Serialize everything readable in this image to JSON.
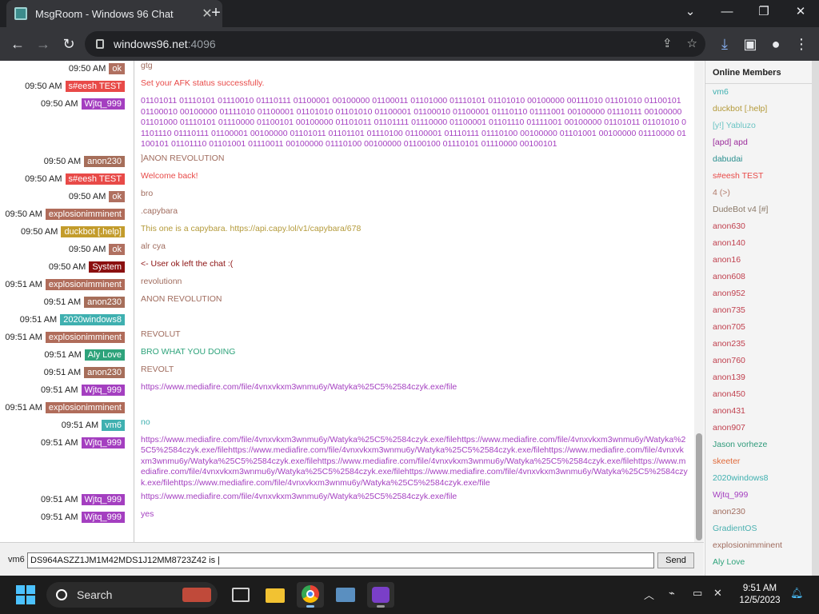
{
  "browser": {
    "tab_title": "MsgRoom - Windows 96 Chat",
    "url_host": "windows96.net",
    "url_port": ":4096"
  },
  "chat": {
    "messages": [
      {
        "time": "09:50 AM",
        "user": "ok",
        "user_color": "#b07060",
        "text": "gtg",
        "text_color": "#a06c5e"
      },
      {
        "time": "09:50 AM",
        "user": "s#eesh TEST",
        "user_color": "#e84a48",
        "text": "Set your AFK status successfully.",
        "text_color": "#e84a48"
      },
      {
        "time": "09:50 AM",
        "user": "Wjtq_999",
        "user_color": "#a43fc0",
        "text": "01101011 01110101 01110010 01110111 01100001 00100000 01100011 01101000 01110101 01101010 00100000 00111010 01101010 01100101 01100010 00100000 01111010 01100001 01101010 01101010 01100001 01100010 01100001 01110110 01111001 00100000 01110111 00100000 01101000 01110101 01110000 01100101 00100000 01101011 01101111 01110000 01100001 01101110 01111001 00100000 01101011 01101010 01101110 01110111 01100001 00100000 01101011 01101101 01110100 01100001 01110111 01110100 00100000 01101001 00100000 01110000 01100101 01101110 01101001 01110011 00100000 01110100 00100000 01100100 01110101 01110000 00100101",
        "text_color": "#a43fc0"
      },
      {
        "time": "09:50 AM",
        "user": "anon230",
        "user_color": "#a66e5a",
        "text": "]ANON REVOLUTION",
        "text_color": "#a06c5e"
      },
      {
        "time": "09:50 AM",
        "user": "s#eesh TEST",
        "user_color": "#e84a48",
        "text": "Welcome back!",
        "text_color": "#e84a48"
      },
      {
        "time": "09:50 AM",
        "user": "ok",
        "user_color": "#b07060",
        "text": "bro",
        "text_color": "#a06c5e"
      },
      {
        "time": "09:50 AM",
        "user": "explosionimminent",
        "user_color": "#b06c5a",
        "text": ".capybara",
        "text_color": "#a06c5e"
      },
      {
        "time": "09:50 AM",
        "user": "duckbot [.help]",
        "user_color": "#c39c2c",
        "text": "This one is a capybara. https://api.capy.lol/v1/capybara/678",
        "text_color": "#b49a3a"
      },
      {
        "time": "09:50 AM",
        "user": "ok",
        "user_color": "#b07060",
        "text": "alr cya",
        "text_color": "#a06c5e"
      },
      {
        "time": "09:50 AM",
        "user": "System",
        "user_color": "#8b1010",
        "text": "<- User ok left the chat :(",
        "text_color": "#8b1010"
      },
      {
        "time": "09:51 AM",
        "user": "explosionimminent",
        "user_color": "#b06c5a",
        "text": "revolutionn",
        "text_color": "#a06c5e"
      },
      {
        "time": "09:51 AM",
        "user": "anon230",
        "user_color": "#a66e5a",
        "text": "ANON REVOLUTION",
        "text_color": "#a06c5e"
      },
      {
        "time": "09:51 AM",
        "user": "2020windows8",
        "user_color": "#3fb0b0",
        "text": "",
        "text_color": "#3fb0b0"
      },
      {
        "time": "09:51 AM",
        "user": "explosionimminent",
        "user_color": "#b06c5a",
        "text": "REVOLUT",
        "text_color": "#a06c5e"
      },
      {
        "time": "09:51 AM",
        "user": "Aly Love",
        "user_color": "#2ea37b",
        "text": "BRO WHAT YOU DOING",
        "text_color": "#2ea37b"
      },
      {
        "time": "09:51 AM",
        "user": "anon230",
        "user_color": "#a66e5a",
        "text": "REVOLT",
        "text_color": "#a06c5e"
      },
      {
        "time": "09:51 AM",
        "user": "Wjtq_999",
        "user_color": "#a43fc0",
        "text": "https://www.mediafire.com/file/4vnxvkxm3wnmu6y/Watyka%25C5%2584czyk.exe/file",
        "text_color": "#a43fc0"
      },
      {
        "time": "09:51 AM",
        "user": "explosionimminent",
        "user_color": "#b06c5a",
        "text": "",
        "text_color": "#a06c5e"
      },
      {
        "time": "09:51 AM",
        "user": "vm6",
        "user_color": "#3fb0b0",
        "text": "no",
        "text_color": "#3fb0b0"
      },
      {
        "time": "09:51 AM",
        "user": "Wjtq_999",
        "user_color": "#a43fc0",
        "text": "https://www.mediafire.com/file/4vnxvkxm3wnmu6y/Watyka%25C5%2584czyk.exe/filehttps://www.mediafire.com/file/4vnxvkxm3wnmu6y/Watyka%25C5%2584czyk.exe/filehttps://www.mediafire.com/file/4vnxvkxm3wnmu6y/Watyka%25C5%2584czyk.exe/filehttps://www.mediafire.com/file/4vnxvkxm3wnmu6y/Watyka%25C5%2584czyk.exe/filehttps://www.mediafire.com/file/4vnxvkxm3wnmu6y/Watyka%25C5%2584czyk.exe/filehttps://www.mediafire.com/file/4vnxvkxm3wnmu6y/Watyka%25C5%2584czyk.exe/filehttps://www.mediafire.com/file/4vnxvkxm3wnmu6y/Watyka%25C5%2584czyk.exe/filehttps://www.mediafire.com/file/4vnxvkxm3wnmu6y/Watyka%25C5%2584czyk.exe/file",
        "text_color": "#a43fc0"
      },
      {
        "time": "09:51 AM",
        "user": "Wjtq_999",
        "user_color": "#a43fc0",
        "text": "https://www.mediafire.com/file/4vnxvkxm3wnmu6y/Watyka%25C5%2584czyk.exe/file",
        "text_color": "#a43fc0"
      },
      {
        "time": "09:51 AM",
        "user": "Wjtq_999",
        "user_color": "#a43fc0",
        "text": "yes",
        "text_color": "#a43fc0"
      }
    ],
    "input_user": "vm6",
    "input_value": "DS964ASZZ1JM1M42MDS1J12MM8723Z42 is |",
    "send_label": "Send"
  },
  "members": {
    "title": "Online Members",
    "list": [
      {
        "name": "vm6",
        "color": "#3fb0b0"
      },
      {
        "name": "duckbot [.help]",
        "color": "#b49a3a"
      },
      {
        "name": "[y!] Yabluzo",
        "color": "#6bc4c4"
      },
      {
        "name": "[apd] apd",
        "color": "#9b2c9b"
      },
      {
        "name": "dabudai",
        "color": "#2a8f8f"
      },
      {
        "name": "s#eesh TEST",
        "color": "#e84a48"
      },
      {
        "name": "4 (>)",
        "color": "#b07a6a"
      },
      {
        "name": "DudeBot v4 [#]",
        "color": "#8a7868"
      },
      {
        "name": "anon630",
        "color": "#c0404e"
      },
      {
        "name": "anon140",
        "color": "#c0404e"
      },
      {
        "name": "anon16",
        "color": "#c0404e"
      },
      {
        "name": "anon608",
        "color": "#c0404e"
      },
      {
        "name": "anon952",
        "color": "#c0404e"
      },
      {
        "name": "anon735",
        "color": "#c0404e"
      },
      {
        "name": "anon705",
        "color": "#c0404e"
      },
      {
        "name": "anon235",
        "color": "#c0404e"
      },
      {
        "name": "anon760",
        "color": "#c0404e"
      },
      {
        "name": "anon139",
        "color": "#c0404e"
      },
      {
        "name": "anon450",
        "color": "#c0404e"
      },
      {
        "name": "anon431",
        "color": "#c0404e"
      },
      {
        "name": "anon907",
        "color": "#c0404e"
      },
      {
        "name": "Jason vorheze",
        "color": "#2e9a7a"
      },
      {
        "name": "skeeter",
        "color": "#e06a3a"
      },
      {
        "name": "2020windows8",
        "color": "#3fb0b0"
      },
      {
        "name": "Wjtq_999",
        "color": "#a43fc0"
      },
      {
        "name": "anon230",
        "color": "#a06c5e"
      },
      {
        "name": "GradientOS",
        "color": "#4ab0b0"
      },
      {
        "name": "explosionimminent",
        "color": "#a06c5e"
      },
      {
        "name": "Aly Love",
        "color": "#2ea37b"
      }
    ]
  },
  "taskbar": {
    "search_label": "Search",
    "time": "9:51 AM",
    "date": "12/5/2023"
  }
}
